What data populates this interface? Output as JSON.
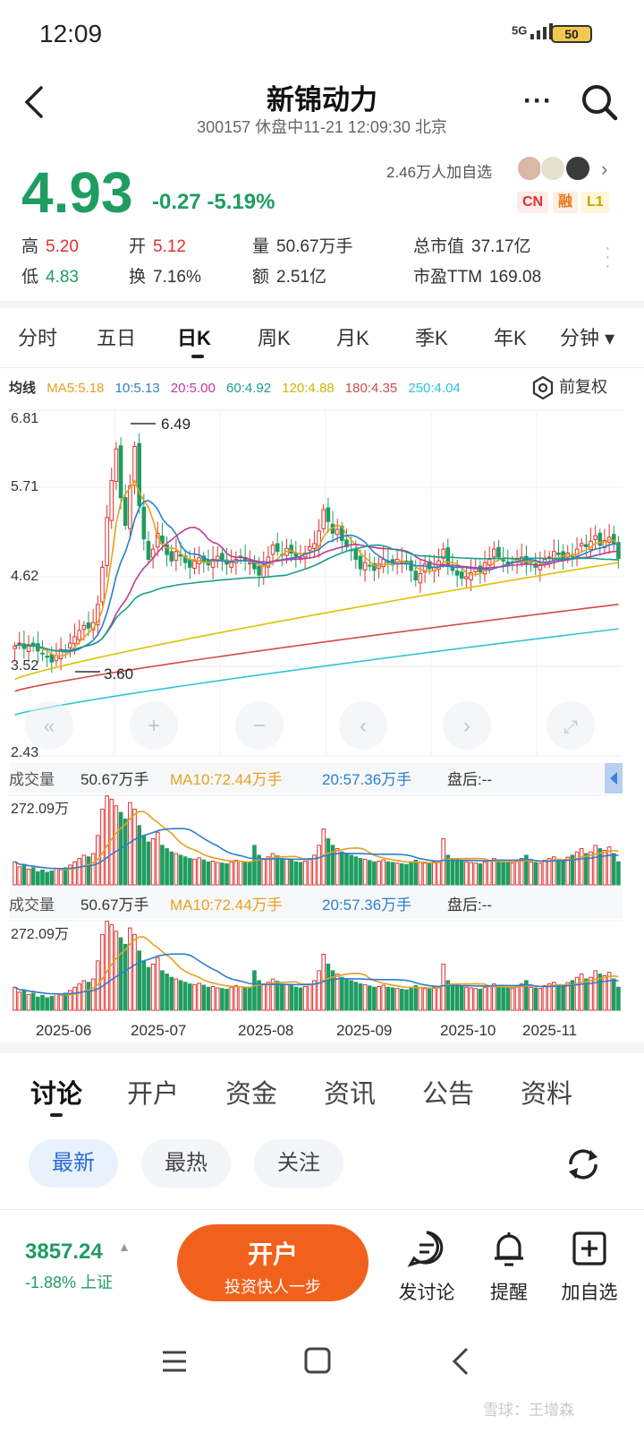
{
  "status": {
    "time": "12:09",
    "network": "5G",
    "battery": "50"
  },
  "header": {
    "title": "新锦动力",
    "subtitle": "300157 休盘中11-21 12:09:30 北京"
  },
  "quote": {
    "price": "4.93",
    "change": "-0.27 -5.19%",
    "followers": "2.46万人加自选",
    "tags": [
      "CN",
      "融",
      "L1"
    ],
    "stats": [
      {
        "label": "高",
        "value": "5.20",
        "tone": "red"
      },
      {
        "label": "开",
        "value": "5.12",
        "tone": "red"
      },
      {
        "label": "量",
        "value": "50.67万手",
        "tone": "plain"
      },
      {
        "label": "总市值",
        "value": "37.17亿",
        "tone": "plain"
      },
      {
        "label": "低",
        "value": "4.83",
        "tone": "green"
      },
      {
        "label": "换",
        "value": "7.16%",
        "tone": "plain"
      },
      {
        "label": "额",
        "value": "2.51亿",
        "tone": "plain"
      },
      {
        "label": "市盈TTM",
        "value": "169.08",
        "tone": "plain"
      }
    ]
  },
  "period_tabs": [
    "分时",
    "五日",
    "日K",
    "周K",
    "月K",
    "季K",
    "年K",
    "分钟 ▾"
  ],
  "active_period": "日K",
  "ma_row": [
    {
      "text": "均线",
      "color": "#333333"
    },
    {
      "text": "MA5:5.18",
      "color": "#e8a020"
    },
    {
      "text": "10:5.13",
      "color": "#2a7fd0"
    },
    {
      "text": "20:5.00",
      "color": "#c0399b"
    },
    {
      "text": "60:4.92",
      "color": "#16a08a"
    },
    {
      "text": "120:4.88",
      "color": "#e0c000"
    },
    {
      "text": "180:4.35",
      "color": "#d24a4a"
    },
    {
      "text": "250:4.04",
      "color": "#2ec4d8"
    }
  ],
  "fuquan": "前复权",
  "volume_header": {
    "label": "成交量",
    "vol": "50.67万手",
    "ma10": "MA10:72.44万手",
    "ma20": "20:57.36万手",
    "after": "盘后:--",
    "max": "272.09万"
  },
  "chart_data": {
    "type": "candlestick",
    "y_ticks": [
      "6.81",
      "5.71",
      "4.62",
      "3.52",
      "2.43"
    ],
    "ylim": [
      2.43,
      6.81
    ],
    "high_annotation": "6.49",
    "low_annotation": "3.60",
    "x_ticks": [
      "2025-06",
      "2025-07",
      "2025-08",
      "2025-09",
      "2025-10",
      "2025-11"
    ],
    "ma_last": {
      "MA5": 5.18,
      "MA10": 5.13,
      "MA20": 5.0,
      "MA60": 4.92,
      "MA120": 4.88,
      "MA180": 4.35,
      "MA250": 4.04
    },
    "close_series": [
      3.82,
      3.86,
      3.79,
      3.84,
      3.82,
      3.76,
      3.72,
      3.68,
      3.62,
      3.7,
      3.78,
      3.76,
      3.86,
      3.94,
      4.02,
      4.08,
      4.05,
      4.12,
      4.35,
      4.82,
      5.45,
      5.92,
      6.32,
      5.7,
      5.35,
      5.85,
      6.35,
      5.6,
      5.18,
      4.92,
      5.05,
      5.25,
      5.12,
      4.98,
      4.9,
      5.02,
      4.96,
      4.88,
      4.82,
      4.9,
      4.94,
      4.88,
      4.85,
      4.92,
      4.96,
      4.9,
      4.86,
      4.88,
      4.92,
      4.95,
      4.9,
      4.88,
      4.8,
      4.72,
      4.85,
      4.95,
      5.1,
      5.02,
      4.98,
      5.06,
      5.0,
      4.96,
      4.94,
      5.0,
      5.08,
      5.12,
      5.28,
      5.55,
      5.4,
      5.25,
      5.3,
      5.16,
      5.08,
      5.04,
      4.92,
      4.8,
      4.88,
      4.84,
      4.78,
      4.86,
      4.92,
      4.88,
      4.85,
      4.92,
      4.9,
      4.86,
      4.78,
      4.66,
      4.74,
      4.86,
      4.8,
      4.82,
      4.9,
      5.05,
      4.86,
      4.78,
      4.72,
      4.68,
      4.7,
      4.75,
      4.8,
      4.76,
      4.88,
      4.92,
      5.05,
      4.95,
      4.9,
      4.85,
      4.88,
      4.92,
      4.95,
      4.86,
      4.88,
      4.82,
      4.85,
      4.92,
      4.95,
      5.02,
      4.98,
      4.94,
      5.0,
      4.96,
      5.05,
      5.12,
      5.08,
      5.15,
      5.22,
      5.1,
      5.16,
      5.2,
      5.12,
      4.93
    ],
    "volume_series": [
      70,
      55,
      60,
      48,
      52,
      40,
      45,
      38,
      42,
      50,
      46,
      52,
      60,
      70,
      80,
      90,
      85,
      95,
      150,
      230,
      270,
      260,
      240,
      220,
      200,
      250,
      230,
      180,
      150,
      130,
      140,
      160,
      120,
      110,
      100,
      95,
      90,
      85,
      80,
      78,
      82,
      76,
      70,
      72,
      68,
      66,
      64,
      70,
      75,
      72,
      68,
      70,
      120,
      90,
      80,
      85,
      95,
      88,
      80,
      78,
      75,
      70,
      68,
      72,
      80,
      90,
      120,
      170,
      140,
      120,
      110,
      100,
      95,
      90,
      85,
      80,
      78,
      74,
      70,
      72,
      76,
      70,
      68,
      66,
      64,
      62,
      70,
      75,
      68,
      66,
      64,
      70,
      72,
      140,
      90,
      80,
      76,
      72,
      70,
      68,
      66,
      64,
      70,
      72,
      80,
      76,
      70,
      68,
      66,
      72,
      80,
      90,
      70,
      68,
      66,
      75,
      80,
      85,
      78,
      76,
      84,
      90,
      100,
      110,
      95,
      100,
      120,
      110,
      105,
      115,
      95,
      70
    ]
  },
  "bottom_tabs": [
    "讨论",
    "开户",
    "资金",
    "资讯",
    "公告",
    "资料"
  ],
  "filters": [
    "最新",
    "最热",
    "关注"
  ],
  "index": {
    "value": "3857.24",
    "change": "-1.88% 上证"
  },
  "open_button": {
    "title": "开户",
    "subtitle": "投资快人一步"
  },
  "actions": [
    {
      "label": "发讨论",
      "icon": "comment-icon"
    },
    {
      "label": "提醒",
      "icon": "bell-icon"
    },
    {
      "label": "加自选",
      "icon": "add-watchlist-icon"
    }
  ],
  "watermark": "雪球：王增森"
}
